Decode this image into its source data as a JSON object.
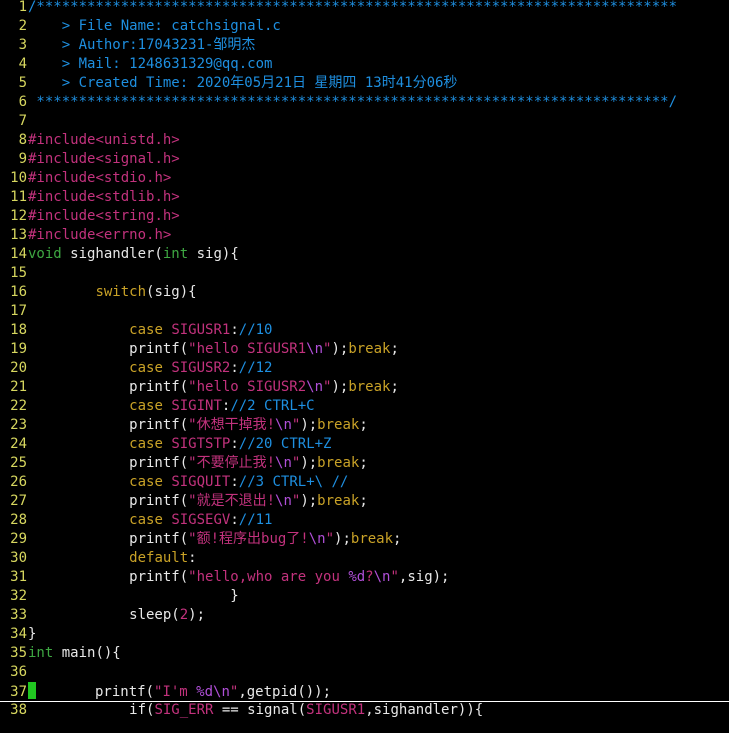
{
  "editor": {
    "lines": [
      {
        "n": "1",
        "tokens": [
          {
            "t": "cmt",
            "v": "/****************************************************************************"
          }
        ]
      },
      {
        "n": "2",
        "tokens": [
          {
            "t": "cmt",
            "v": "    > File Name: catchsignal.c"
          }
        ]
      },
      {
        "n": "3",
        "tokens": [
          {
            "t": "cmt",
            "v": "    > Author:17043231-邹明杰"
          }
        ]
      },
      {
        "n": "4",
        "tokens": [
          {
            "t": "cmt",
            "v": "    > Mail: 1248631329@qq.com"
          }
        ]
      },
      {
        "n": "5",
        "tokens": [
          {
            "t": "cmt",
            "v": "    > Created Time: 2020年05月21日 星期四 13时41分06秒"
          }
        ]
      },
      {
        "n": "6",
        "tokens": [
          {
            "t": "cmt",
            "v": " ***************************************************************************/"
          }
        ]
      },
      {
        "n": "7",
        "tokens": []
      },
      {
        "n": "8",
        "tokens": [
          {
            "t": "pre",
            "v": "#include"
          },
          {
            "t": "inc",
            "v": "<unistd.h>"
          }
        ]
      },
      {
        "n": "9",
        "tokens": [
          {
            "t": "pre",
            "v": "#include"
          },
          {
            "t": "inc",
            "v": "<signal.h>"
          }
        ]
      },
      {
        "n": "10",
        "tokens": [
          {
            "t": "pre",
            "v": "#include"
          },
          {
            "t": "inc",
            "v": "<stdio.h>"
          }
        ]
      },
      {
        "n": "11",
        "tokens": [
          {
            "t": "pre",
            "v": "#include"
          },
          {
            "t": "inc",
            "v": "<stdlib.h>"
          }
        ]
      },
      {
        "n": "12",
        "tokens": [
          {
            "t": "pre",
            "v": "#include"
          },
          {
            "t": "inc",
            "v": "<string.h>"
          }
        ]
      },
      {
        "n": "13",
        "tokens": [
          {
            "t": "pre",
            "v": "#include"
          },
          {
            "t": "inc",
            "v": "<errno.h>"
          }
        ]
      },
      {
        "n": "14",
        "tokens": [
          {
            "t": "type",
            "v": "void"
          },
          {
            "t": "plain",
            "v": " sighandler("
          },
          {
            "t": "type",
            "v": "int"
          },
          {
            "t": "plain",
            "v": " sig){"
          }
        ]
      },
      {
        "n": "15",
        "tokens": []
      },
      {
        "n": "16",
        "tokens": [
          {
            "t": "plain",
            "v": "        "
          },
          {
            "t": "kw",
            "v": "switch"
          },
          {
            "t": "plain",
            "v": "(sig){"
          }
        ]
      },
      {
        "n": "17",
        "tokens": []
      },
      {
        "n": "18",
        "tokens": [
          {
            "t": "plain",
            "v": "            "
          },
          {
            "t": "kw",
            "v": "case"
          },
          {
            "t": "plain",
            "v": " "
          },
          {
            "t": "const",
            "v": "SIGUSR1"
          },
          {
            "t": "plain",
            "v": ":"
          },
          {
            "t": "cmt",
            "v": "//10"
          }
        ]
      },
      {
        "n": "19",
        "tokens": [
          {
            "t": "plain",
            "v": "            printf("
          },
          {
            "t": "str",
            "v": "\"hello SIGUSR1"
          },
          {
            "t": "esc",
            "v": "\\n"
          },
          {
            "t": "str",
            "v": "\""
          },
          {
            "t": "plain",
            "v": ");"
          },
          {
            "t": "kw",
            "v": "break"
          },
          {
            "t": "plain",
            "v": ";"
          }
        ]
      },
      {
        "n": "20",
        "tokens": [
          {
            "t": "plain",
            "v": "            "
          },
          {
            "t": "kw",
            "v": "case"
          },
          {
            "t": "plain",
            "v": " "
          },
          {
            "t": "const",
            "v": "SIGUSR2"
          },
          {
            "t": "plain",
            "v": ":"
          },
          {
            "t": "cmt",
            "v": "//12"
          }
        ]
      },
      {
        "n": "21",
        "tokens": [
          {
            "t": "plain",
            "v": "            printf("
          },
          {
            "t": "str",
            "v": "\"hello SIGUSR2"
          },
          {
            "t": "esc",
            "v": "\\n"
          },
          {
            "t": "str",
            "v": "\""
          },
          {
            "t": "plain",
            "v": ");"
          },
          {
            "t": "kw",
            "v": "break"
          },
          {
            "t": "plain",
            "v": ";"
          }
        ]
      },
      {
        "n": "22",
        "tokens": [
          {
            "t": "plain",
            "v": "            "
          },
          {
            "t": "kw",
            "v": "case"
          },
          {
            "t": "plain",
            "v": " "
          },
          {
            "t": "const",
            "v": "SIGINT"
          },
          {
            "t": "plain",
            "v": ":"
          },
          {
            "t": "cmt",
            "v": "//2 CTRL+C"
          }
        ]
      },
      {
        "n": "23",
        "tokens": [
          {
            "t": "plain",
            "v": "            printf("
          },
          {
            "t": "str",
            "v": "\"休想干掉我!"
          },
          {
            "t": "esc",
            "v": "\\n"
          },
          {
            "t": "str",
            "v": "\""
          },
          {
            "t": "plain",
            "v": ");"
          },
          {
            "t": "kw",
            "v": "break"
          },
          {
            "t": "plain",
            "v": ";"
          }
        ]
      },
      {
        "n": "24",
        "tokens": [
          {
            "t": "plain",
            "v": "            "
          },
          {
            "t": "kw",
            "v": "case"
          },
          {
            "t": "plain",
            "v": " "
          },
          {
            "t": "const",
            "v": "SIGTSTP"
          },
          {
            "t": "plain",
            "v": ":"
          },
          {
            "t": "cmt",
            "v": "//20 CTRL+Z"
          }
        ]
      },
      {
        "n": "25",
        "tokens": [
          {
            "t": "plain",
            "v": "            printf("
          },
          {
            "t": "str",
            "v": "\"不要停止我!"
          },
          {
            "t": "esc",
            "v": "\\n"
          },
          {
            "t": "str",
            "v": "\""
          },
          {
            "t": "plain",
            "v": ");"
          },
          {
            "t": "kw",
            "v": "break"
          },
          {
            "t": "plain",
            "v": ";"
          }
        ]
      },
      {
        "n": "26",
        "tokens": [
          {
            "t": "plain",
            "v": "            "
          },
          {
            "t": "kw",
            "v": "case"
          },
          {
            "t": "plain",
            "v": " "
          },
          {
            "t": "const",
            "v": "SIGQUIT"
          },
          {
            "t": "plain",
            "v": ":"
          },
          {
            "t": "cmt",
            "v": "//3 CTRL+\\ //"
          }
        ]
      },
      {
        "n": "27",
        "tokens": [
          {
            "t": "plain",
            "v": "            printf("
          },
          {
            "t": "str",
            "v": "\"就是不退出!"
          },
          {
            "t": "esc",
            "v": "\\n"
          },
          {
            "t": "str",
            "v": "\""
          },
          {
            "t": "plain",
            "v": ");"
          },
          {
            "t": "kw",
            "v": "break"
          },
          {
            "t": "plain",
            "v": ";"
          }
        ]
      },
      {
        "n": "28",
        "tokens": [
          {
            "t": "plain",
            "v": "            "
          },
          {
            "t": "kw",
            "v": "case"
          },
          {
            "t": "plain",
            "v": " "
          },
          {
            "t": "const",
            "v": "SIGSEGV"
          },
          {
            "t": "plain",
            "v": ":"
          },
          {
            "t": "cmt",
            "v": "//11"
          }
        ]
      },
      {
        "n": "29",
        "tokens": [
          {
            "t": "plain",
            "v": "            printf("
          },
          {
            "t": "str",
            "v": "\"额!程序出bug了!"
          },
          {
            "t": "esc",
            "v": "\\n"
          },
          {
            "t": "str",
            "v": "\""
          },
          {
            "t": "plain",
            "v": ");"
          },
          {
            "t": "kw",
            "v": "break"
          },
          {
            "t": "plain",
            "v": ";"
          }
        ]
      },
      {
        "n": "30",
        "tokens": [
          {
            "t": "plain",
            "v": "            "
          },
          {
            "t": "kw",
            "v": "default"
          },
          {
            "t": "plain",
            "v": ":"
          }
        ]
      },
      {
        "n": "31",
        "tokens": [
          {
            "t": "plain",
            "v": "            printf("
          },
          {
            "t": "str",
            "v": "\"hello,who are you "
          },
          {
            "t": "esc",
            "v": "%d"
          },
          {
            "t": "str",
            "v": "?"
          },
          {
            "t": "esc",
            "v": "\\n"
          },
          {
            "t": "str",
            "v": "\""
          },
          {
            "t": "plain",
            "v": ",sig);"
          }
        ]
      },
      {
        "n": "32",
        "tokens": [
          {
            "t": "plain",
            "v": "                        }"
          }
        ]
      },
      {
        "n": "33",
        "tokens": [
          {
            "t": "plain",
            "v": "            sleep("
          },
          {
            "t": "num",
            "v": "2"
          },
          {
            "t": "plain",
            "v": ");"
          }
        ]
      },
      {
        "n": "34",
        "tokens": [
          {
            "t": "plain",
            "v": "}"
          }
        ]
      },
      {
        "n": "35",
        "tokens": [
          {
            "t": "type",
            "v": "int"
          },
          {
            "t": "plain",
            "v": " main(){"
          }
        ]
      },
      {
        "n": "36",
        "tokens": []
      },
      {
        "n": "37",
        "cursor": true,
        "tokens": [
          {
            "t": "plain",
            "v": "       printf("
          },
          {
            "t": "str",
            "v": "\"I'm "
          },
          {
            "t": "esc",
            "v": "%d"
          },
          {
            "t": "esc",
            "v": "\\n"
          },
          {
            "t": "str",
            "v": "\""
          },
          {
            "t": "plain",
            "v": ",getpid());"
          }
        ]
      },
      {
        "n": "38",
        "tokens": [
          {
            "t": "plain",
            "v": "            if("
          },
          {
            "t": "const",
            "v": "SIG_ERR"
          },
          {
            "t": "plain",
            "v": " == signal("
          },
          {
            "t": "const",
            "v": "SIGUSR1"
          },
          {
            "t": "plain",
            "v": ",sighandler)){"
          }
        ]
      }
    ]
  }
}
